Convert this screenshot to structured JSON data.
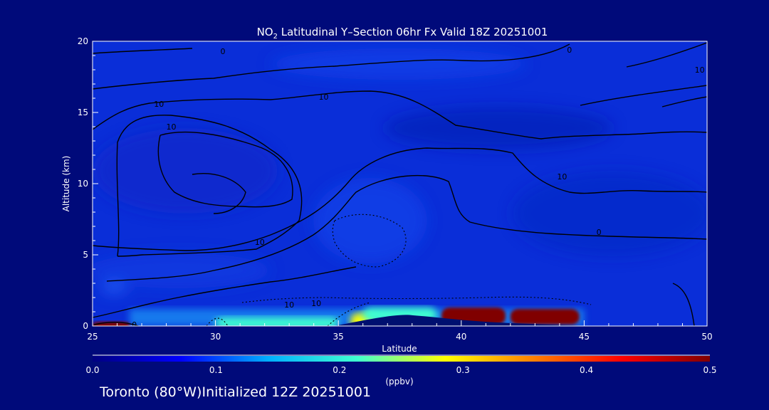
{
  "title": {
    "prefix": "NO",
    "subscript": "2",
    "text": " Latitudinal Y–Section 06hr  Fx Valid 18Z 20251001"
  },
  "footer": {
    "location": "Toronto (80°W)",
    "initialized": "Initialized 12Z 20251001"
  },
  "colors": {
    "background": "#000a7a",
    "plot_base": "#0a2ed8",
    "contour": "#000000"
  },
  "chart_data": {
    "type": "heatmap",
    "xlabel": "Latitude",
    "ylabel": "Altitude (km)",
    "xlim": [
      25,
      50
    ],
    "ylim": [
      0,
      20
    ],
    "x_ticks": [
      25,
      30,
      35,
      40,
      45,
      50
    ],
    "y_ticks": [
      0,
      5,
      10,
      15,
      20
    ],
    "colorbar": {
      "label": "(ppbv)",
      "range": [
        0.0,
        0.5
      ],
      "ticks": [
        "0.0",
        "0.1",
        "0.2",
        "0.3",
        "0.4",
        "0.5"
      ],
      "colors": [
        "#000080",
        "#0000ff",
        "#00b0ff",
        "#40ffd0",
        "#ffff00",
        "#ff8000",
        "#ff0000",
        "#800000"
      ]
    },
    "concentration_features": [
      {
        "lat_range": [
          25.0,
          26.5
        ],
        "alt_range": [
          0.0,
          0.3
        ],
        "value": 0.5
      },
      {
        "lat_range": [
          30.0,
          35.0
        ],
        "alt_range": [
          0.0,
          0.6
        ],
        "value": 0.22
      },
      {
        "lat_range": [
          35.5,
          36.5
        ],
        "alt_range": [
          0.0,
          0.9
        ],
        "value": 0.32
      },
      {
        "lat_range": [
          36.0,
          39.0
        ],
        "alt_range": [
          0.5,
          1.3
        ],
        "value": 0.18
      },
      {
        "lat_range": [
          39.2,
          41.8
        ],
        "alt_range": [
          0.3,
          1.3
        ],
        "value": 0.5
      },
      {
        "lat_range": [
          42.0,
          44.8
        ],
        "alt_range": [
          0.3,
          1.2
        ],
        "value": 0.5
      },
      {
        "lat_range": [
          25.0,
          50.0
        ],
        "alt_range": [
          1.5,
          20.0
        ],
        "value": 0.05
      }
    ],
    "contour_labels": [
      {
        "text": "0",
        "lat": 30.3,
        "alt": 19.3
      },
      {
        "text": "0",
        "lat": 44.4,
        "alt": 19.4
      },
      {
        "text": "10",
        "lat": 49.7,
        "alt": 18.0
      },
      {
        "text": "10",
        "lat": 27.7,
        "alt": 15.6
      },
      {
        "text": "10",
        "lat": 34.4,
        "alt": 16.1
      },
      {
        "text": "10",
        "lat": 28.2,
        "alt": 14.0
      },
      {
        "text": "10",
        "lat": 44.1,
        "alt": 10.5
      },
      {
        "text": "0",
        "lat": 45.6,
        "alt": 6.6
      },
      {
        "text": "10",
        "lat": 31.8,
        "alt": 5.9
      },
      {
        "text": "10",
        "lat": 33.0,
        "alt": 1.5
      },
      {
        "text": "10",
        "lat": 34.1,
        "alt": 1.6
      },
      {
        "text": "0",
        "lat": 26.7,
        "alt": 0.1
      }
    ]
  }
}
